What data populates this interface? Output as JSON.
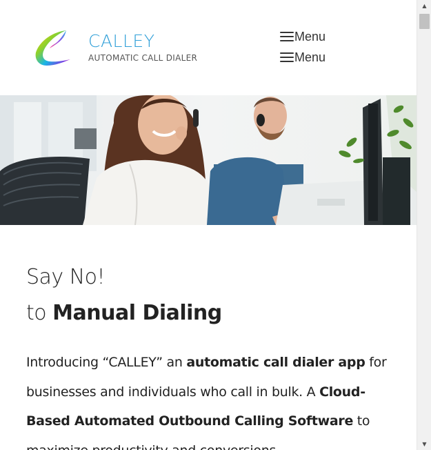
{
  "header": {
    "logo": {
      "name": "CALLEY",
      "tagline": "AUTOMATIC CALL DIALER"
    },
    "menus": [
      {
        "label": "Menu",
        "icon": "hamburger-icon"
      },
      {
        "label": "Menu",
        "icon": "hamburger-icon"
      }
    ]
  },
  "hero": {
    "description_icon": "hero-image"
  },
  "content": {
    "heading_line1": "Say No!",
    "heading_line2_prefix": "to ",
    "heading_line2_bold": "Manual Dialing",
    "intro": {
      "p1": "Introducing “CALLEY” an ",
      "b1": "automatic call dialer app",
      "p2": " for businesses and individuals who call in bulk. A ",
      "b2": "Cloud-Based Automated Outbound Calling Software",
      "p3": " to maximize productivity and conversions."
    }
  },
  "colors": {
    "brand_blue": "#2f9fd8",
    "text": "#222222"
  }
}
